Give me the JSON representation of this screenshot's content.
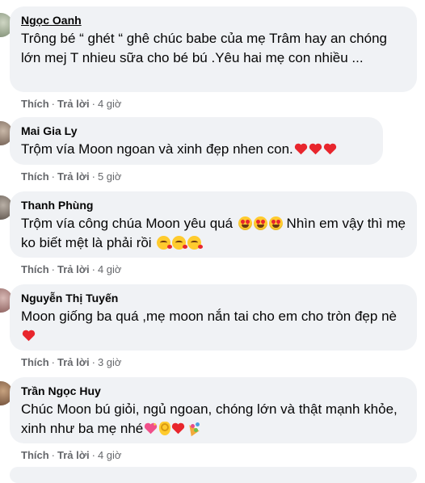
{
  "comments": [
    {
      "author": "Ngọc Oanh",
      "text": "Trông bé “ ghét “ ghê chúc babe của mẹ Trâm hay an chóng lớn mej T nhieu sữa cho bé bú .Yêu hai mẹ con nhiều ...",
      "like_label": "Thích",
      "reply_label": "Trả lời",
      "time": "4 giờ"
    },
    {
      "author": "Mai Gia Ly",
      "text": "Trộm vía Moon ngoan và xinh đẹp nhen con.",
      "like_label": "Thích",
      "reply_label": "Trả lời",
      "time": "5 giờ"
    },
    {
      "author": "Thanh Phùng",
      "text_part1": "Trộm vía công chúa Moon yêu quá",
      "text_part2": "Nhìn em vậy thì mẹ ko biết mệt là phải rồi",
      "like_label": "Thích",
      "reply_label": "Trả lời",
      "time": "4 giờ"
    },
    {
      "author": "Nguyễn Thị Tuyến",
      "text": "Moon giống ba quá ,mẹ moon nắn tai cho em cho tròn đẹp nè",
      "like_label": "Thích",
      "reply_label": "Trả lời",
      "time": "3 giờ"
    },
    {
      "author": "Trần Ngọc Huy",
      "text": "Chúc Moon bú giỏi, ngủ ngoan, chóng lớn và thật mạnh khỏe, xinh như ba mẹ nhé",
      "like_label": "Thích",
      "reply_label": "Trả lời",
      "time": "4 giờ"
    }
  ],
  "separator": "·",
  "colors": {
    "bubble_bg": "#f0f2f5",
    "text": "#050505",
    "meta": "#65676b",
    "heart": "#e8262d"
  }
}
